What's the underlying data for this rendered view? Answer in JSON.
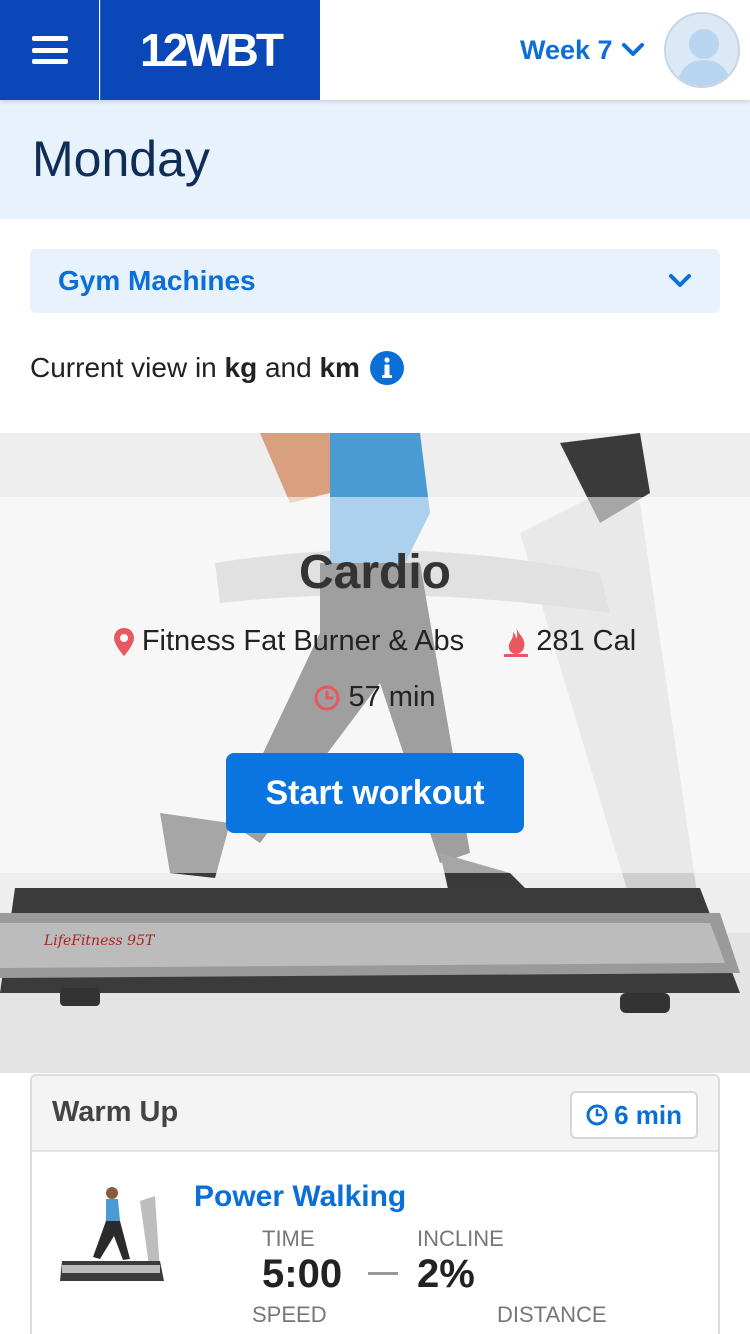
{
  "header": {
    "logo": "12WBT",
    "week_label": "Week 7",
    "menu_icon": "hamburger-icon",
    "avatar_icon": "avatar-placeholder"
  },
  "day": {
    "title": "Monday"
  },
  "dropdown": {
    "label": "Gym Machines"
  },
  "units": {
    "prefix": "Current view in ",
    "unit_weight": "kg",
    "conjunction": " and ",
    "unit_distance": "km"
  },
  "hero": {
    "title": "Cardio",
    "location": "Fitness Fat Burner & Abs",
    "calories": "281 Cal",
    "duration": "57 min",
    "start_button": "Start workout"
  },
  "warmup": {
    "title": "Warm Up",
    "duration": "6 min",
    "exercise": {
      "name": "Power Walking",
      "time_label": "TIME",
      "time_value": "5:00",
      "incline_label": "INCLINE",
      "incline_value": "2%",
      "speed_label": "SPEED",
      "distance_label": "DISTANCE"
    }
  },
  "colors": {
    "brand_blue": "#0a47b8",
    "link_blue": "#0a6fd6",
    "button_blue": "#0a74e0",
    "icon_red": "#e8585e",
    "band_blue": "#e8f2fc"
  }
}
